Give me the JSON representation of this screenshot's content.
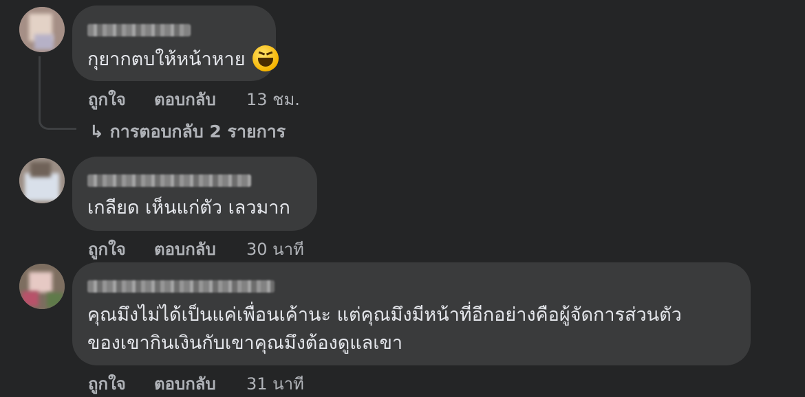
{
  "comments": [
    {
      "text": "กุยากตบให้หน้าหาย",
      "emoji": "laughing-face",
      "actions": {
        "like": "ถูกใจ",
        "reply": "ตอบกลับ",
        "time": "13 ชม."
      },
      "replies_link": "การตอบกลับ 2 รายการ",
      "replies_arrow": "↳"
    },
    {
      "text": "เกลียด เห็นแก่ตัว เลวมาก",
      "actions": {
        "like": "ถูกใจ",
        "reply": "ตอบกลับ",
        "time": "30 นาที"
      }
    },
    {
      "text_line1": "คุณมึงไม่ได้เป็นแค่เพื่อนเค้านะ แต่คุณมึงมีหน้าที่อีกอย่างคือผู้จัดการส่วนตัว",
      "text_line2": "ของเขากินเงินกับเขาคุณมึงต้องดูแลเขา",
      "actions": {
        "like": "ถูกใจ",
        "reply": "ตอบกลับ",
        "time": "31 นาที"
      }
    }
  ],
  "colors": {
    "background": "#242526",
    "bubble": "#3a3b3c",
    "text": "#e4e6eb",
    "secondary": "#b0b3b8"
  }
}
